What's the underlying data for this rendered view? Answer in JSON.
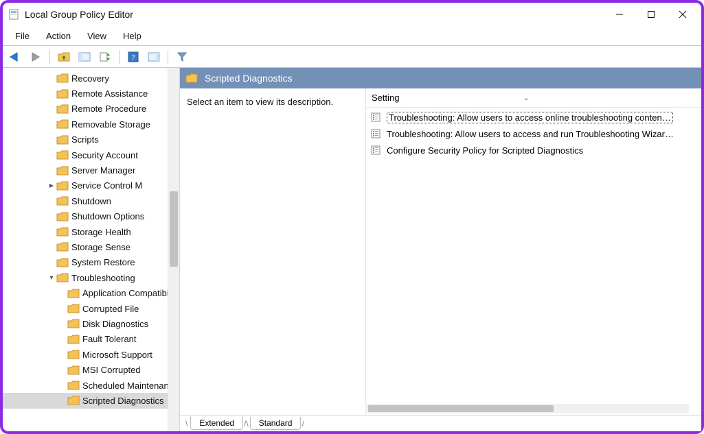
{
  "window": {
    "title": "Local Group Policy Editor"
  },
  "menu": {
    "items": [
      "File",
      "Action",
      "View",
      "Help"
    ]
  },
  "toolbar": {
    "icons": [
      "back",
      "forward",
      "up-folder",
      "show-hide-tree",
      "export-list",
      "help",
      "show-hide-action"
    ]
  },
  "tree": {
    "items": [
      {
        "label": "Recovery",
        "depth": 4,
        "expander": ""
      },
      {
        "label": "Remote Assistance",
        "depth": 4,
        "expander": ""
      },
      {
        "label": "Remote Procedure",
        "depth": 4,
        "expander": ""
      },
      {
        "label": "Removable Storage",
        "depth": 4,
        "expander": ""
      },
      {
        "label": "Scripts",
        "depth": 4,
        "expander": ""
      },
      {
        "label": "Security Account",
        "depth": 4,
        "expander": ""
      },
      {
        "label": "Server Manager",
        "depth": 4,
        "expander": ""
      },
      {
        "label": "Service Control M",
        "depth": 4,
        "expander": ">"
      },
      {
        "label": "Shutdown",
        "depth": 4,
        "expander": ""
      },
      {
        "label": "Shutdown Options",
        "depth": 4,
        "expander": ""
      },
      {
        "label": "Storage Health",
        "depth": 4,
        "expander": ""
      },
      {
        "label": "Storage Sense",
        "depth": 4,
        "expander": ""
      },
      {
        "label": "System Restore",
        "depth": 4,
        "expander": ""
      },
      {
        "label": "Troubleshooting",
        "depth": 4,
        "expander": "v"
      },
      {
        "label": "Application Compatibility",
        "depth": 5,
        "expander": ""
      },
      {
        "label": "Corrupted File",
        "depth": 5,
        "expander": ""
      },
      {
        "label": "Disk Diagnostics",
        "depth": 5,
        "expander": ""
      },
      {
        "label": "Fault Tolerant",
        "depth": 5,
        "expander": ""
      },
      {
        "label": "Microsoft Support",
        "depth": 5,
        "expander": ""
      },
      {
        "label": "MSI Corrupted",
        "depth": 5,
        "expander": ""
      },
      {
        "label": "Scheduled Maintenance",
        "depth": 5,
        "expander": ""
      },
      {
        "label": "Scripted Diagnostics",
        "depth": 5,
        "expander": "",
        "selected": true
      }
    ]
  },
  "detail": {
    "header": "Scripted Diagnostics",
    "description": "Select an item to view its description.",
    "settings_header": "Setting",
    "settings": [
      {
        "label": "Troubleshooting: Allow users to access online troubleshooting conten…",
        "focused": true
      },
      {
        "label": "Troubleshooting: Allow users to access and run Troubleshooting Wizar…",
        "focused": false
      },
      {
        "label": "Configure Security Policy for Scripted Diagnostics",
        "focused": false
      }
    ],
    "tabs": [
      "Extended",
      "Standard"
    ],
    "active_tab": 0
  }
}
